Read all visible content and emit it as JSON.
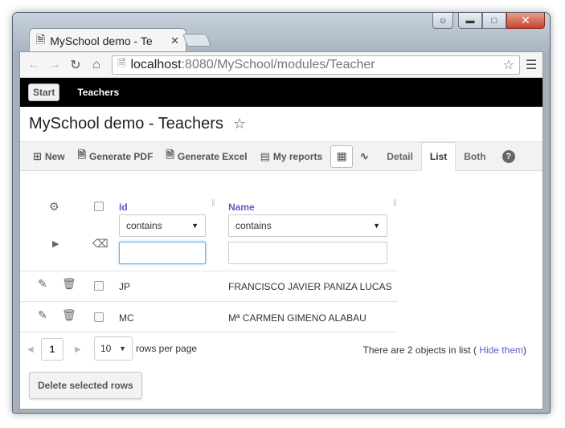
{
  "browser": {
    "tab_title": "MySchool demo - Te",
    "url_host": "localhost",
    "url_path": ":8080/MySchool/modules/Teacher"
  },
  "app": {
    "start_label": "Start",
    "teachers_label": "Teachers",
    "page_title": "MySchool demo - Teachers"
  },
  "toolbar": {
    "new_label": "New",
    "pdf_label": "Generate PDF",
    "excel_label": "Generate Excel",
    "reports_label": "My reports",
    "detail_label": "Detail",
    "list_label": "List",
    "both_label": "Both",
    "help_label": "?"
  },
  "grid": {
    "columns": [
      {
        "header": "Id",
        "filter_op": "contains",
        "filter_value": ""
      },
      {
        "header": "Name",
        "filter_op": "contains",
        "filter_value": ""
      }
    ],
    "rows": [
      {
        "id": "JP",
        "name": "FRANCISCO JAVIER PANIZA LUCAS"
      },
      {
        "id": "MC",
        "name": "Mª CARMEN GIMENO ALABAU"
      }
    ]
  },
  "pager": {
    "current_page": "1",
    "rows_per_page": "10",
    "rows_per_page_label": "rows per page",
    "count_text": "There are 2 objects in list (",
    "hide_label": "Hide them",
    "close_paren": ")"
  },
  "actions": {
    "delete_selected_label": "Delete selected rows"
  }
}
